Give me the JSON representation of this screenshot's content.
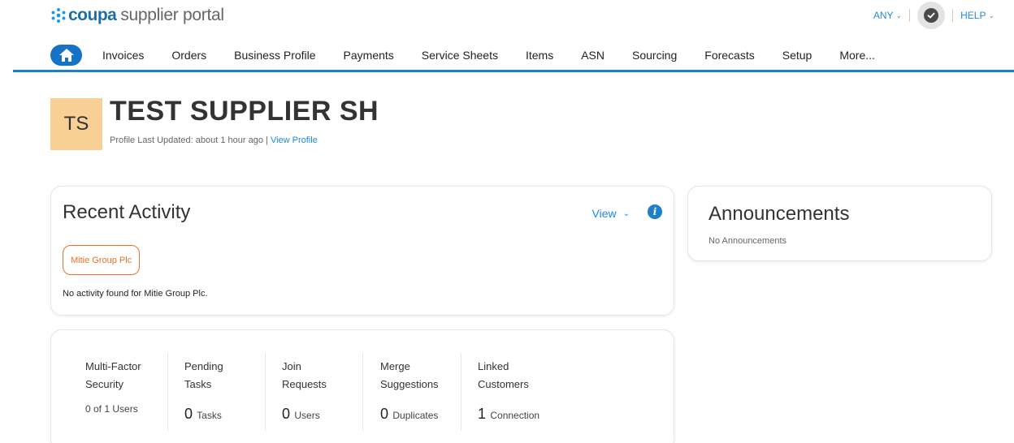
{
  "brand": {
    "name": "coupa",
    "subtitle": "supplier portal",
    "accent": "#1b6ea8"
  },
  "util": {
    "any_label": "ANY",
    "help_label": "HELP",
    "check_icon": "check-circle-icon"
  },
  "nav": {
    "home_icon": "home-icon",
    "items": [
      "Invoices",
      "Orders",
      "Business Profile",
      "Payments",
      "Service Sheets",
      "Items",
      "ASN",
      "Sourcing",
      "Forecasts",
      "Setup",
      "More..."
    ]
  },
  "profile": {
    "initials": "TS",
    "name": "TEST SUPPLIER SH",
    "updated_text": "Profile Last Updated: about 1 hour ago | ",
    "view_profile": "View Profile"
  },
  "recent_activity": {
    "title": "Recent Activity",
    "view_label": "View",
    "info_icon": "info-icon",
    "customer_chip": "Mitie Group Plc",
    "empty_text": "No activity found for Mitie Group Plc."
  },
  "announcements": {
    "title": "Announcements",
    "empty_text": "No Announcements"
  },
  "stats": [
    {
      "line1": "Multi-Factor",
      "line2": "Security",
      "value": "",
      "unit": "0 of 1 Users"
    },
    {
      "line1": "Pending",
      "line2": "Tasks",
      "value": "0",
      "unit": "Tasks"
    },
    {
      "line1": "Join",
      "line2": "Requests",
      "value": "0",
      "unit": "Users"
    },
    {
      "line1": "Merge",
      "line2": "Suggestions",
      "value": "0",
      "unit": "Duplicates"
    },
    {
      "line1": "Linked",
      "line2": "Customers",
      "value": "1",
      "unit": "Connection"
    }
  ]
}
